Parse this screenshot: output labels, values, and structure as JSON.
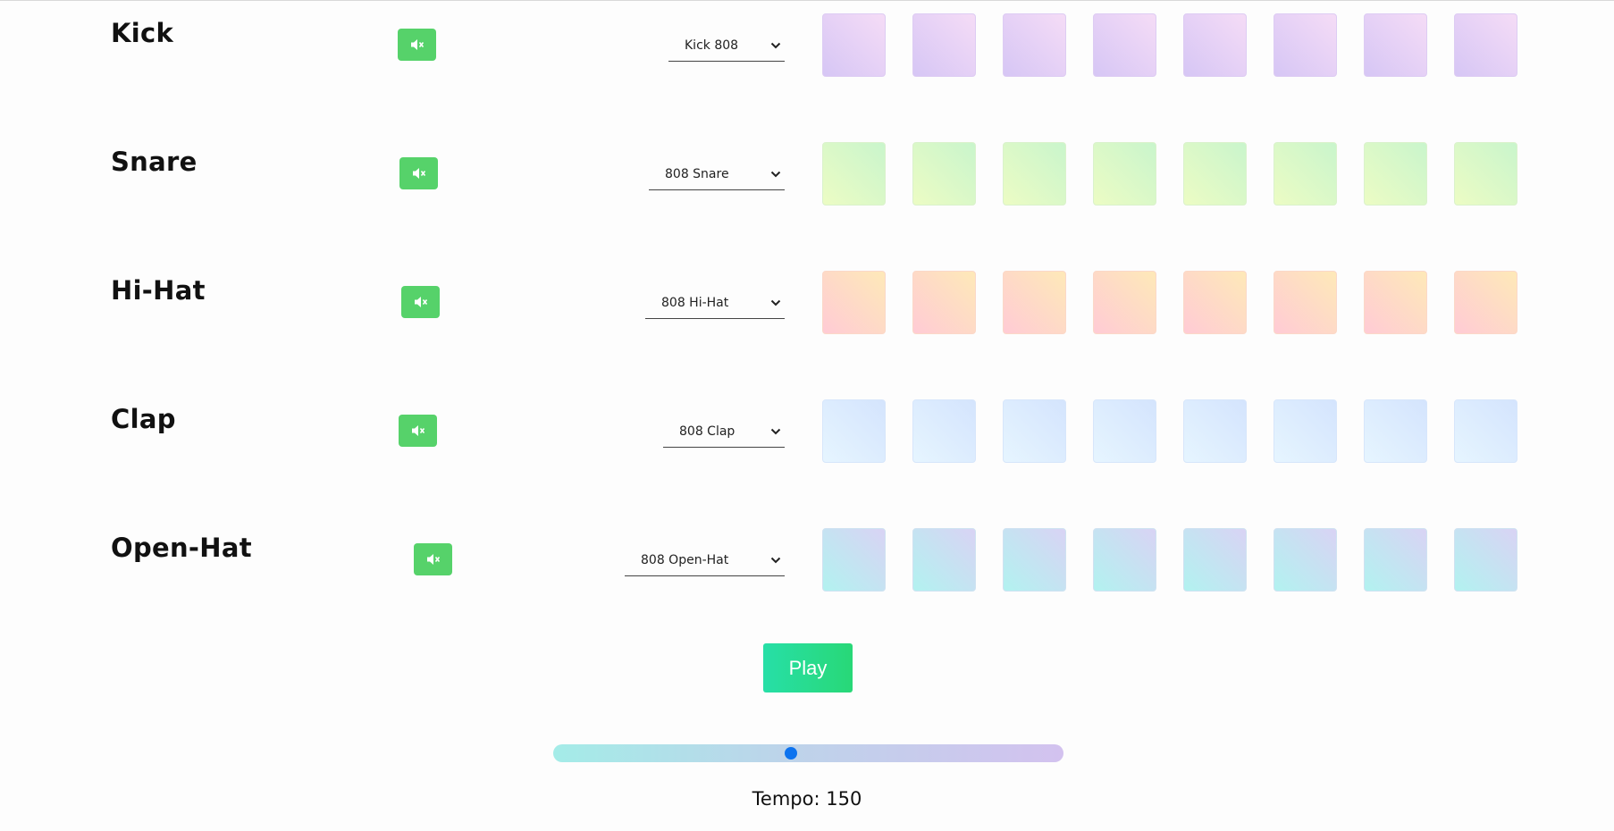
{
  "tracks": [
    {
      "id": "kick",
      "name": "Kick",
      "sound": "Kick 808",
      "muted": false,
      "steps": [
        false,
        false,
        false,
        false,
        false,
        false,
        false,
        false
      ]
    },
    {
      "id": "snare",
      "name": "Snare",
      "sound": "808 Snare",
      "muted": false,
      "steps": [
        false,
        false,
        false,
        false,
        false,
        false,
        false,
        false
      ]
    },
    {
      "id": "hihat",
      "name": "Hi-Hat",
      "sound": "808 Hi-Hat",
      "muted": false,
      "steps": [
        false,
        false,
        false,
        false,
        false,
        false,
        false,
        false
      ]
    },
    {
      "id": "clap",
      "name": "Clap",
      "sound": "808 Clap",
      "muted": false,
      "steps": [
        false,
        false,
        false,
        false,
        false,
        false,
        false,
        false
      ]
    },
    {
      "id": "openhat",
      "name": "Open-Hat",
      "sound": "808 Open-Hat",
      "muted": false,
      "steps": [
        false,
        false,
        false,
        false,
        false,
        false,
        false,
        false
      ]
    }
  ],
  "mute_icon": "volume-mute-icon",
  "dropdown_icon": "chevron-down-icon",
  "controls": {
    "play_label": "Play",
    "tempo_label": "Tempo: 150",
    "tempo_value": 150,
    "tempo_slider_fraction": 0.465
  },
  "colors": {
    "mute_button": "#56d26a",
    "play_button": "#27dfa7",
    "slider_thumb": "#0d73ef"
  }
}
